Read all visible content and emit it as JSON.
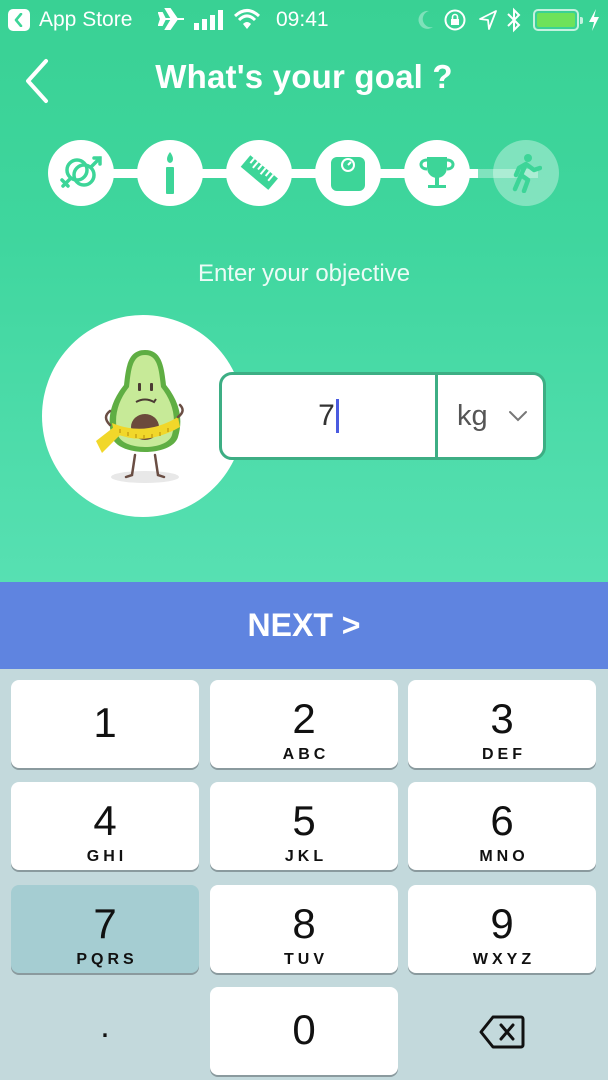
{
  "status_bar": {
    "back_app": "App Store",
    "time": "09:41",
    "icons": [
      "back-app-icon",
      "airplane-icon",
      "signal-icon",
      "wifi-icon",
      "moon-icon",
      "rotation-lock-icon",
      "location-icon",
      "bluetooth-icon",
      "battery-icon",
      "charging-icon"
    ],
    "battery_percent": 100
  },
  "header": {
    "title": "What's your goal ?",
    "back_icon": "chevron-left-icon"
  },
  "stepper": {
    "steps": [
      {
        "icon": "gender-icon",
        "state": "done"
      },
      {
        "icon": "birthday-candle-icon",
        "state": "done"
      },
      {
        "icon": "ruler-icon",
        "state": "done"
      },
      {
        "icon": "scale-icon",
        "state": "done"
      },
      {
        "icon": "trophy-icon",
        "state": "done"
      },
      {
        "icon": "running-person-icon",
        "state": "current"
      }
    ]
  },
  "form": {
    "subtitle": "Enter your objective",
    "illustration": "avocado-measuring-tape",
    "value": "7",
    "unit": "kg"
  },
  "next_button": {
    "label": "NEXT >"
  },
  "keypad": {
    "keys": [
      {
        "num": "1",
        "letters": ""
      },
      {
        "num": "2",
        "letters": "ABC"
      },
      {
        "num": "3",
        "letters": "DEF"
      },
      {
        "num": "4",
        "letters": "GHI"
      },
      {
        "num": "5",
        "letters": "JKL"
      },
      {
        "num": "6",
        "letters": "MNO"
      },
      {
        "num": "7",
        "letters": "PQRS"
      },
      {
        "num": "8",
        "letters": "TUV"
      },
      {
        "num": "9",
        "letters": "WXYZ"
      },
      {
        "num": ".",
        "letters": ""
      },
      {
        "num": "0",
        "letters": ""
      }
    ],
    "pressed_key": "7",
    "delete_icon": "backspace-icon"
  },
  "colors": {
    "primary_green": "#3dd598",
    "button_blue": "#5f84e0",
    "keypad_bg": "#c3d9dc",
    "caret": "#4a5be0"
  }
}
